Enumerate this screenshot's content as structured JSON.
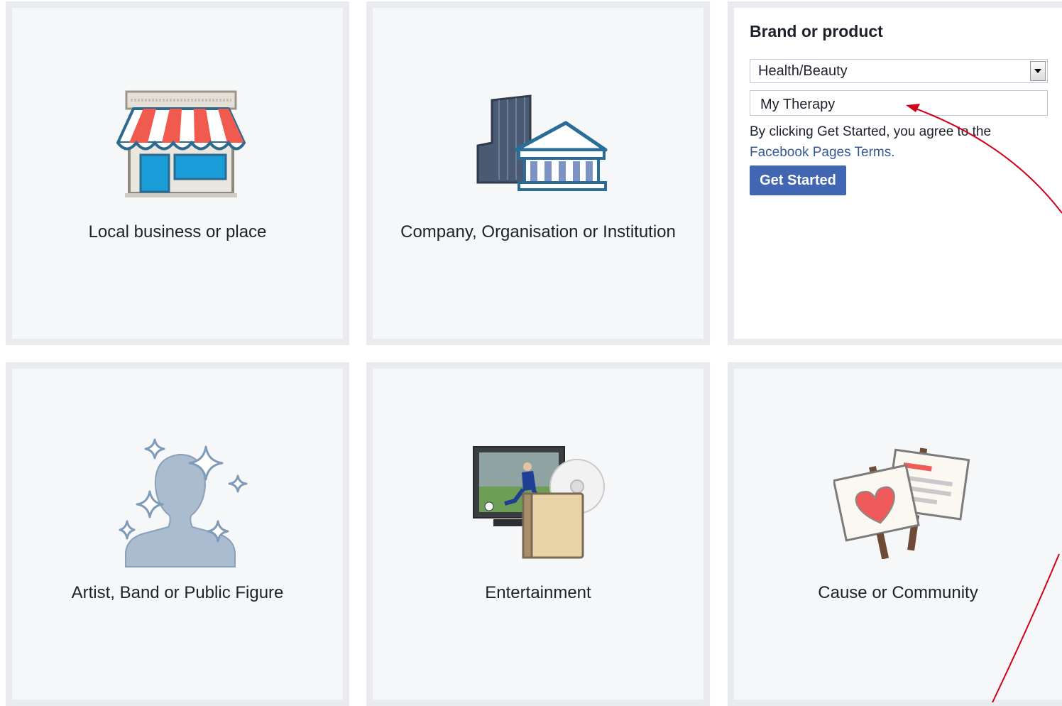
{
  "categories": {
    "local_business": {
      "label": "Local business or place",
      "icon": "storefront-icon"
    },
    "company": {
      "label": "Company, Organisation or Institution",
      "icon": "buildings-icon"
    },
    "artist": {
      "label": "Artist, Band or Public Figure",
      "icon": "person-sparkles-icon"
    },
    "entertainment": {
      "label": "Entertainment",
      "icon": "tv-disc-book-icon"
    },
    "cause": {
      "label": "Cause or Community",
      "icon": "protest-signs-icon"
    }
  },
  "brand_panel": {
    "title": "Brand or product",
    "category_select": {
      "value": "Health/Beauty"
    },
    "name_input": {
      "value": "My Therapy"
    },
    "terms_text": "By clicking Get Started, you agree to the",
    "terms_link": "Facebook Pages Terms.",
    "button_label": "Get Started"
  },
  "colors": {
    "tile_bg": "#f6f7f9",
    "tile_border": "#e9ebee",
    "button": "#4267b2",
    "link": "#365899",
    "annotation": "#d0021b"
  }
}
